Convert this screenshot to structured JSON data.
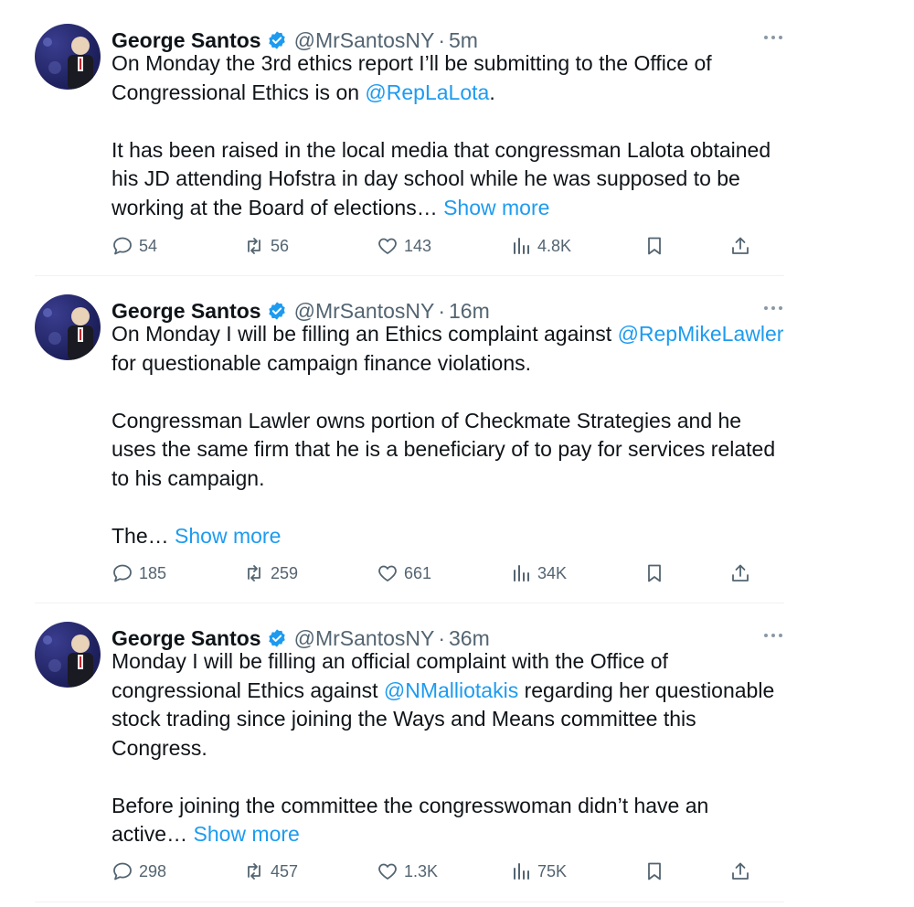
{
  "tweets": [
    {
      "name": "George Santos",
      "handle": "@MrSantosNY",
      "dot": "·",
      "time": "5m",
      "p1_before": "On Monday the 3rd ethics report I’ll be submitting to the Office of Congressional Ethics is on ",
      "p1_mention": "@RepLaLota",
      "p1_after": ".",
      "p2": "It has been raised in the local media that congressman Lalota obtained his JD attending Hofstra in day school while he was supposed to be working at the Board of elections…",
      "show_more": "Show more",
      "replies": "54",
      "reposts": "56",
      "likes": "143",
      "views": "4.8K"
    },
    {
      "name": "George Santos",
      "handle": "@MrSantosNY",
      "dot": "·",
      "time": "16m",
      "p1_before": "On Monday I will be filling an Ethics complaint against ",
      "p1_mention": "@RepMikeLawler",
      "p1_after": " for questionable campaign finance violations.",
      "p2": "Congressman Lawler owns portion of Checkmate Strategies and he uses the same firm that he is a beneficiary of to pay for services related to his campaign.",
      "p3": "The…",
      "show_more": "Show more",
      "replies": "185",
      "reposts": "259",
      "likes": "661",
      "views": "34K"
    },
    {
      "name": "George Santos",
      "handle": "@MrSantosNY",
      "dot": "·",
      "time": "36m",
      "p1_before": "Monday I will be filling an official complaint with the Office of congressional Ethics against ",
      "p1_mention": "@NMalliotakis",
      "p1_after": " regarding her questionable stock trading since joining the Ways and Means committee this Congress.",
      "p2": "Before joining the committee the congresswoman didn’t have an active…",
      "show_more": "Show more",
      "replies": "298",
      "reposts": "457",
      "likes": "1.3K",
      "views": "75K"
    }
  ],
  "icons": {
    "verified": "verified-badge-icon",
    "more": "more-dots-icon",
    "reply": "reply-icon",
    "repost": "repost-icon",
    "like": "like-icon",
    "views": "views-icon",
    "bookmark": "bookmark-icon",
    "share": "share-icon"
  },
  "colors": {
    "link": "#1d9bf0",
    "muted": "#536471",
    "verified": "#1d9bf0"
  }
}
